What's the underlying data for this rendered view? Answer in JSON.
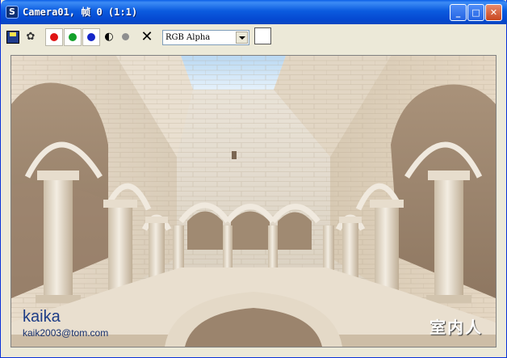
{
  "window": {
    "title": "Camera01, 帧 0 (1:1)",
    "minimize_glyph": "_",
    "maximize_glyph": "□",
    "close_glyph": "✕"
  },
  "toolbar": {
    "icons": [
      "save-icon",
      "clone-icon",
      "red-channel-icon",
      "green-channel-icon",
      "blue-channel-icon",
      "alpha-toggle-icon",
      "monochrome-icon",
      "clear-icon"
    ],
    "channel_colors": {
      "red": "#e01414",
      "green": "#12a02a",
      "blue": "#1426c8"
    },
    "clear_glyph": "✕",
    "alpha_glyph": "◐",
    "channel_select": {
      "value": "RGB Alpha"
    },
    "swatch_color": "#ffffff"
  },
  "render": {
    "watermark_name": "kaika",
    "watermark_email": "kaik2003@tom.com",
    "watermark_site": "室内人"
  },
  "colors": {
    "title_bar": "#0a57e0",
    "window_frame": "#ece9d8",
    "close_button": "#d4582f"
  }
}
